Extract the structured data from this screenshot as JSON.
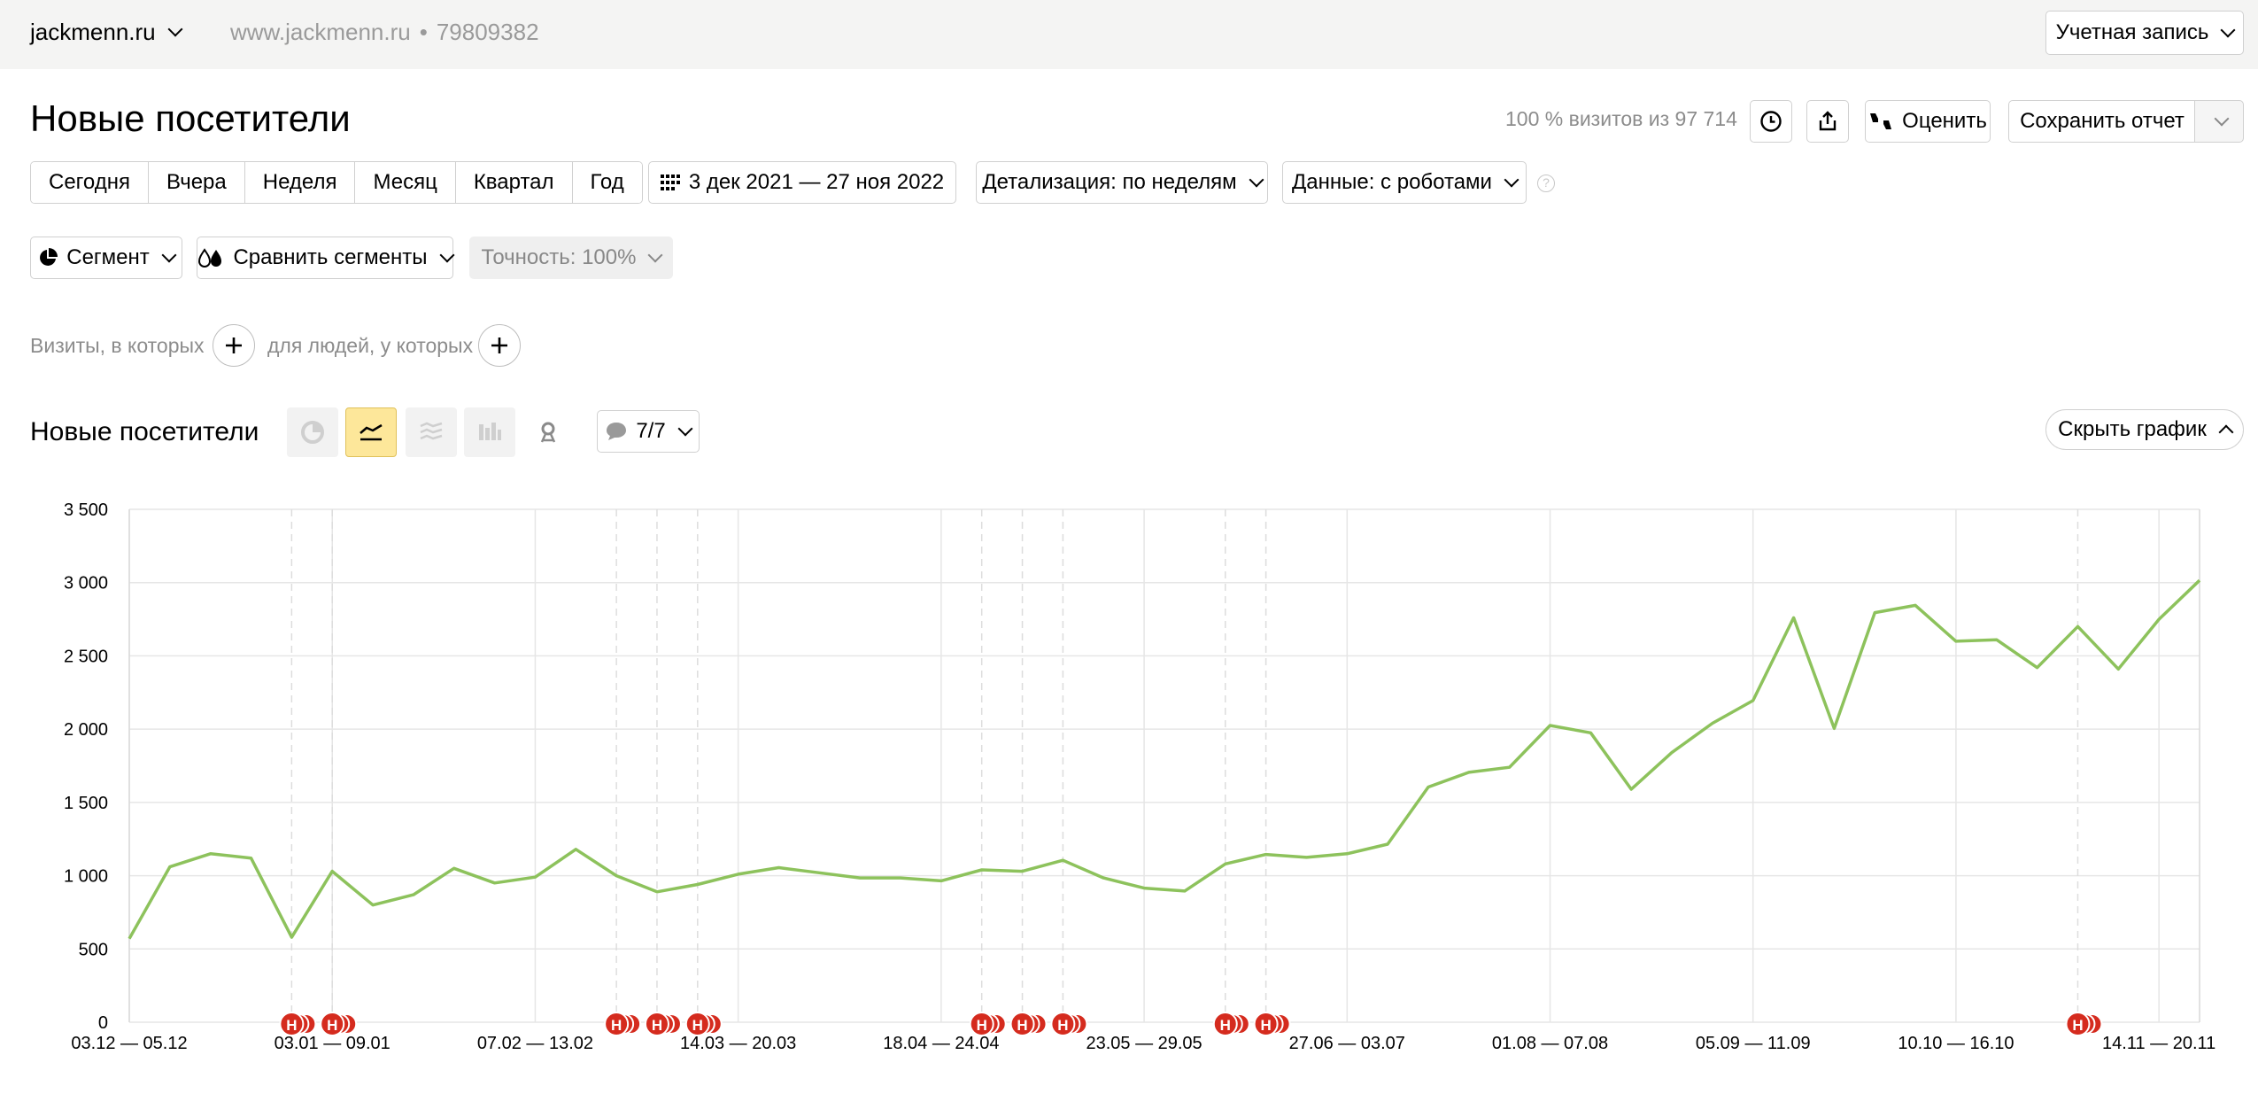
{
  "topbar": {
    "site_name": "jackmenn.ru",
    "site_url": "www.jackmenn.ru",
    "separator": "•",
    "counter_id": "79809382",
    "account_label": "Учетная запись"
  },
  "header": {
    "title": "Новые посетители",
    "visits_info": "100 % визитов из 97 714",
    "rate_label": "Оценить",
    "save_report_label": "Сохранить отчет"
  },
  "toolbar": {
    "periods": [
      "Сегодня",
      "Вчера",
      "Неделя",
      "Месяц",
      "Квартал",
      "Год"
    ],
    "date_range": "3 дек 2021 — 27 ноя 2022",
    "detail_label": "Детализация: по неделям",
    "data_label": "Данные: с роботами",
    "help_glyph": "?"
  },
  "segments": {
    "segment_label": "Сегмент",
    "compare_label": "Сравнить сегменты",
    "accuracy_label": "Точность: 100%"
  },
  "filters": {
    "visits_label": "Визиты, в которых",
    "people_label": "для людей, у которых"
  },
  "chart_panel": {
    "title": "Новые посетители",
    "annotations_count": "7/7",
    "hide_chart_label": "Скрыть график"
  },
  "colors": {
    "line": "#8dc25c",
    "annotation": "#d52b1e",
    "active_chart_type": "#fde79a",
    "grid": "#e6e6e6"
  },
  "icons": {
    "site_select": "chevron-down-icon",
    "history": "clock-icon",
    "export": "share-upload-icon",
    "rate": "thumbs-icon",
    "calendar": "calendar-grid-icon",
    "segment": "pie-icon",
    "compare": "drops-icon",
    "add_filter": "plus-icon",
    "chart_types": [
      "pie-chart-icon",
      "line-chart-icon",
      "stacked-area-chart-icon",
      "bar-chart-icon",
      "map-pin-icon"
    ],
    "annotations": "speech-bubble-icon",
    "annotation_marker": "annotation-marker-icon"
  },
  "chart_data": {
    "type": "line",
    "title": "",
    "xlabel": "",
    "ylabel": "",
    "ylim": [
      0,
      3500
    ],
    "y_ticks": [
      "0",
      "500",
      "1 000",
      "1 500",
      "2 000",
      "2 500",
      "3 000",
      "3 500"
    ],
    "x_tick_labels": [
      "03.12 — 05.12",
      "03.01 — 09.01",
      "07.02 — 13.02",
      "14.03 — 20.03",
      "18.04 — 24.04",
      "23.05 — 29.05",
      "27.06 — 03.07",
      "01.08 — 07.08",
      "05.09 — 11.09",
      "10.10 — 16.10",
      "14.11 — 20.11"
    ],
    "x_tick_indices": [
      0,
      5,
      10,
      15,
      20,
      25,
      30,
      35,
      40,
      45,
      50
    ],
    "grid": true,
    "annotation_label": "Н",
    "annotation_indices": [
      4,
      5,
      12,
      13,
      14,
      21,
      22,
      23,
      27,
      28,
      48
    ],
    "series": [
      {
        "values": [
          570,
          1060,
          1150,
          1120,
          580,
          1030,
          800,
          870,
          1050,
          950,
          990,
          1180,
          1000,
          890,
          940,
          1010,
          1055,
          1020,
          985,
          985,
          965,
          1040,
          1030,
          1105,
          985,
          915,
          895,
          1080,
          1145,
          1125,
          1150,
          1215,
          1605,
          1705,
          1740,
          2025,
          1975,
          1590,
          1840,
          2040,
          2195,
          2760,
          2005,
          2795,
          2845,
          2600,
          2610,
          2420,
          2700,
          2410,
          2750,
          3015
        ]
      }
    ]
  }
}
